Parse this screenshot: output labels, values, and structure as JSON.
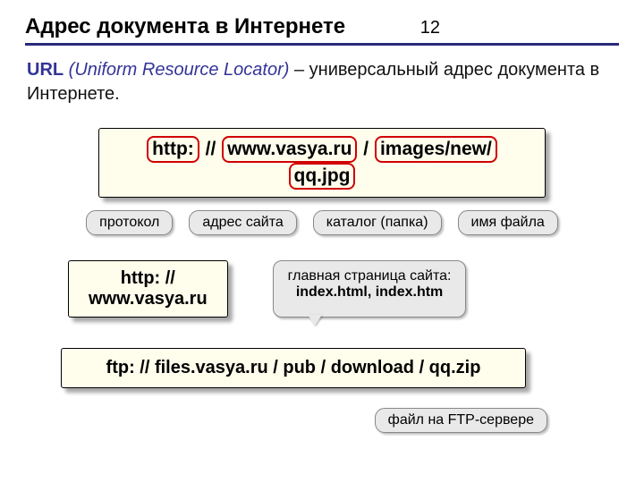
{
  "page_number": "12",
  "title": "Адрес документа в Интернете",
  "definition": {
    "url_abbrev": "URL",
    "url_expansion": "(Uniform Resource Locator)",
    "rest": " – универсальный адрес документа в Интернете."
  },
  "url_parts": {
    "protocol": "http:",
    "sep1": " // ",
    "host": "www.vasya.ru",
    "sep2": " / ",
    "path": "images/new/",
    "file": "qq.jpg"
  },
  "part_labels": {
    "protocol": "протокол",
    "host": "адрес сайта",
    "path": "каталог (папка)",
    "file": "имя файла"
  },
  "short_url": {
    "line1": "http: //",
    "line2": "www.vasya.ru"
  },
  "index_note": {
    "line1": "главная страница сайта:",
    "line2": "index.html, index.htm"
  },
  "ftp_url": "ftp: // files.vasya.ru / pub / download / qq.zip",
  "ftp_label": "файл на FTP-сервере"
}
